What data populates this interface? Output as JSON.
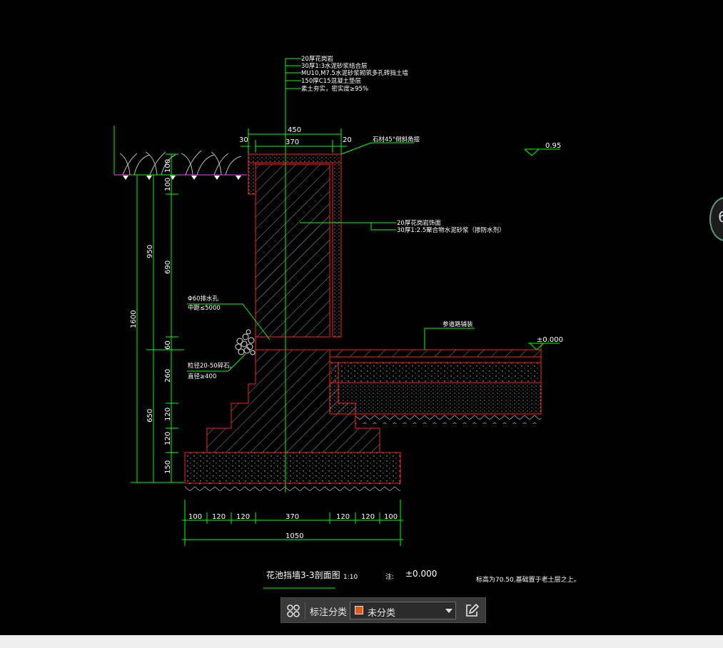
{
  "drawing": {
    "callout_layers": [
      "20厚花岗岩",
      "30厚1:3水泥砂浆结合层",
      "MU10,M7.5水泥砂浆砌筑多孔砖挡土墙",
      "150厚C15混凝土垫层",
      "素土夯实，密实度≥95%"
    ],
    "top_width": "450",
    "inner_width": "370",
    "left_edge": "30",
    "right_edge": "20",
    "chamfer_note": "石材45°倒斜角接",
    "level_top": "0.95",
    "wall_facing_1": "20厚花岗岩饰面",
    "wall_facing_2": "30厚1:2.5聚合物水泥砂浆（掺防水剂）",
    "drain_pipe_1": "Φ60排水孔",
    "drain_pipe_2": "中距≤5000",
    "gravel_1": "粒径20-50碎石,",
    "gravel_2": "直径≥400",
    "paving_note": "参道路铺装",
    "level_zero": "±0.000",
    "vert_total": "1600",
    "vert_950": "950",
    "vert_650": "650",
    "vert_100a": "100",
    "vert_100b": "100",
    "vert_690": "690",
    "vert_60": "60",
    "vert_260": "260",
    "vert_120a": "120",
    "vert_120b": "120",
    "vert_150": "150",
    "bottom_dims": [
      "100",
      "120",
      "120",
      "370",
      "120",
      "120",
      "100"
    ],
    "bottom_total": "1050",
    "title": "花池挡墙3-3剖面图",
    "scale": "1:10",
    "note_label": "注:",
    "note_level": "±0.000",
    "note_text": "标高为70.50,基础置于老土层之上。"
  },
  "toolbar": {
    "label": "标注分类",
    "selected": "未分类",
    "swatch_color": "#e05a1a",
    "grid_icon": "grid-icon",
    "edit_icon": "edit-icon"
  },
  "side_button": {
    "label": "6"
  },
  "colors": {
    "background": "#000000",
    "outline": "#ff2020",
    "dimension": "#00ff00",
    "text": "#ffffff",
    "magenta": "#ff40ff"
  }
}
